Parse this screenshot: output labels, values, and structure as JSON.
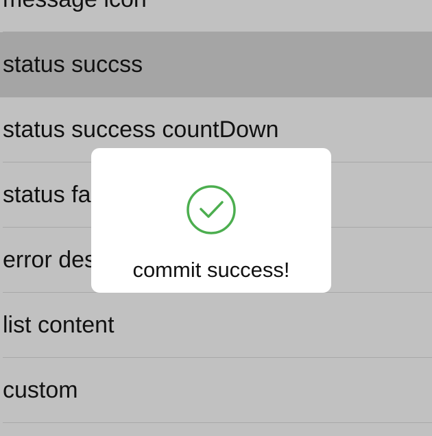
{
  "list": {
    "items": [
      {
        "label": "message icon"
      },
      {
        "label": "status succss"
      },
      {
        "label": "status success countDown"
      },
      {
        "label": "status fail"
      },
      {
        "label": "error desc"
      },
      {
        "label": "list content"
      },
      {
        "label": "custom"
      }
    ],
    "highlighted_index": 1
  },
  "toast": {
    "icon": "check-circle-icon",
    "message": "commit success!",
    "accent_color": "#4cae4f"
  }
}
